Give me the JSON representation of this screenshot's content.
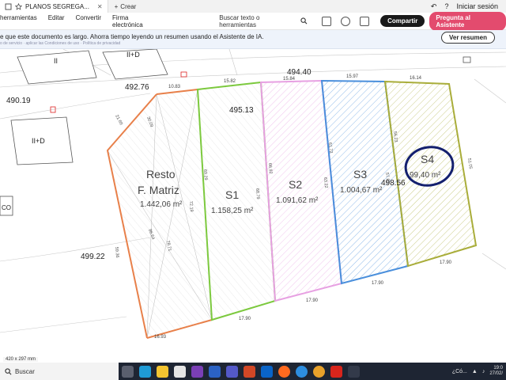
{
  "tabbar": {
    "tab_title": "PLANOS SEGREGA...",
    "new_tab_label": "Crear",
    "sign_in": "Iniciar sesión"
  },
  "toolbar": {
    "menu": [
      "herramientas",
      "Editar",
      "Convertir",
      "Firma electrónica"
    ],
    "search_label": "Buscar texto o herramientas",
    "share_label": "Compartir",
    "ai_label": "Pregunta al Asistente"
  },
  "banner": {
    "message": "e que este documento es largo. Ahorra tiempo leyendo un resumen usando el Asistente de IA.",
    "subtext": "o de servicio · aplicar las Condiciones de uso · Política de privacidad",
    "summary_button": "Ver resumen"
  },
  "plan": {
    "labels": {
      "resto_line1": "Resto",
      "resto_line2": "F. Matriz",
      "resto_area": "1.442,06 m²",
      "s1": "S1",
      "s1_area": "1.158,25 m²",
      "s2": "S2",
      "s2_area": "1.091,62 m²",
      "s3": "S3",
      "s3_area": "1.004,67 m²",
      "s4": "S4",
      "s4_area": "99,40 m²"
    },
    "elevations": [
      "490.19",
      "492.76",
      "494.40",
      "495.13",
      "498.56",
      "499.22"
    ],
    "building_codes": [
      "II",
      "II+D",
      "II+D",
      "CO"
    ],
    "dimensions_top": [
      "10.83",
      "15.82",
      "15.84",
      "15.97",
      "16.14"
    ],
    "dimensions_bottom": [
      "16.93",
      "17.90",
      "17.90",
      "17.90",
      "17.90"
    ],
    "dimensions_lines": [
      "21.69",
      "30.09",
      "59.36",
      "69.29",
      "72.19",
      "68.79",
      "66.92",
      "63.22",
      "61.72",
      "57.89",
      "56.23",
      "51.05",
      "86.64",
      "78.71"
    ],
    "colors": {
      "resto": "#e8804a",
      "s1": "#7cc93e",
      "s2": "#e7a0e2",
      "s3": "#4a8fdc",
      "s4": "#a9ad3a",
      "circle": "#14206e"
    }
  },
  "page_size": "420 x 297 mm",
  "taskbar": {
    "search_label": "Buscar",
    "tray_text": "¿Có...",
    "time": "19:0",
    "date": "27/02/"
  }
}
